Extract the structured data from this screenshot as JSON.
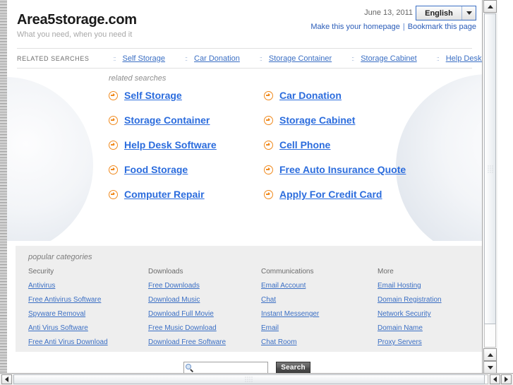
{
  "browser": {
    "scrollbar_vertical": "vertical-scrollbar",
    "scrollbar_horizontal": "horizontal-scrollbar"
  },
  "header": {
    "site_title": "Area5storage.com",
    "tagline": "What you need, when you need it",
    "date": "June 13, 2011",
    "language": {
      "selected": "English",
      "options": [
        "English"
      ]
    },
    "links": [
      {
        "label": "Make this your homepage"
      },
      {
        "label": "Bookmark this page"
      }
    ],
    "divider": "|"
  },
  "nav": {
    "label": "RELATED SEARCHES",
    "separator": "::",
    "items": [
      {
        "label": "Self Storage"
      },
      {
        "label": "Car Donation"
      },
      {
        "label": "Storage Container"
      },
      {
        "label": "Storage Cabinet"
      },
      {
        "label": "Help Desk Software"
      }
    ]
  },
  "related_searches": {
    "heading": "related searches",
    "items": [
      {
        "label": "Self Storage"
      },
      {
        "label": "Car Donation"
      },
      {
        "label": "Storage Container"
      },
      {
        "label": "Storage Cabinet"
      },
      {
        "label": "Help Desk Software"
      },
      {
        "label": "Cell Phone"
      },
      {
        "label": "Food Storage"
      },
      {
        "label": "Free Auto Insurance Quote"
      },
      {
        "label": "Computer Repair"
      },
      {
        "label": "Apply For Credit Card"
      }
    ]
  },
  "popular_categories": {
    "heading": "popular categories",
    "columns": [
      {
        "title": "Security",
        "links": [
          {
            "label": "Antivirus"
          },
          {
            "label": "Free Antivirus Software"
          },
          {
            "label": "Spyware Removal"
          },
          {
            "label": "Anti Virus Software"
          },
          {
            "label": "Free Anti Virus Download"
          }
        ]
      },
      {
        "title": "Downloads",
        "links": [
          {
            "label": "Free Downloads"
          },
          {
            "label": "Download Music"
          },
          {
            "label": "Download Full Movie"
          },
          {
            "label": "Free Music Download"
          },
          {
            "label": "Download Free Software"
          }
        ]
      },
      {
        "title": "Communications",
        "links": [
          {
            "label": "Email Account"
          },
          {
            "label": "Chat"
          },
          {
            "label": "Instant Messenger"
          },
          {
            "label": "Email"
          },
          {
            "label": "Chat Room"
          }
        ]
      },
      {
        "title": "More",
        "links": [
          {
            "label": "Email Hosting"
          },
          {
            "label": "Domain Registration"
          },
          {
            "label": "Network Security"
          },
          {
            "label": "Domain Name"
          },
          {
            "label": "Proxy Servers"
          }
        ]
      }
    ]
  },
  "search": {
    "value": "",
    "placeholder": "",
    "button_label": "Search",
    "icon": "magnifier-icon"
  },
  "colors": {
    "link_blue": "#3b6fc4",
    "heading_blue": "#2b6cdd",
    "bullet_orange": "#f08a1e",
    "panel_gray": "#eeeeee"
  }
}
